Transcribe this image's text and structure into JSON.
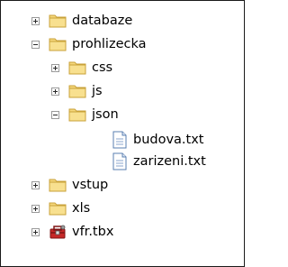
{
  "tree": {
    "items": [
      {
        "label": "databaze",
        "icon": "folder-icon",
        "state": "collapsed"
      },
      {
        "label": "prohlizecka",
        "icon": "folder-icon",
        "state": "expanded"
      },
      {
        "label": "css",
        "icon": "folder-icon",
        "state": "collapsed"
      },
      {
        "label": "js",
        "icon": "folder-icon",
        "state": "collapsed"
      },
      {
        "label": "json",
        "icon": "folder-icon",
        "state": "expanded"
      },
      {
        "label": "budova.txt",
        "icon": "text-file-icon"
      },
      {
        "label": "zarizeni.txt",
        "icon": "text-file-icon"
      },
      {
        "label": "vstup",
        "icon": "folder-icon",
        "state": "collapsed"
      },
      {
        "label": "xls",
        "icon": "folder-icon",
        "state": "collapsed"
      },
      {
        "label": "vfr.tbx",
        "icon": "toolbox-icon",
        "state": "collapsed"
      }
    ]
  },
  "colors": {
    "folder_fill": "#f5d77a",
    "folder_edge": "#c9a23a",
    "toolbox_red": "#c62828"
  }
}
